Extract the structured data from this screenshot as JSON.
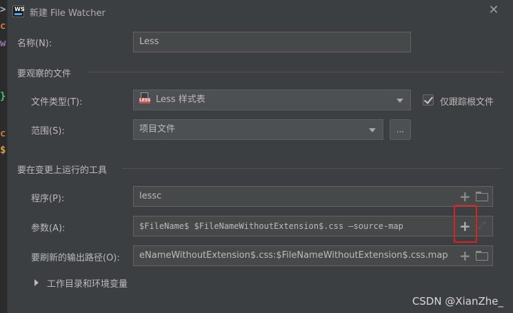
{
  "editor_gutter": {
    "glyphs": [
      {
        "text": ">",
        "color": "#a9b7c6"
      },
      {
        "text": "c",
        "color": "#cc7832"
      },
      {
        "text": "w",
        "color": "#9876aa"
      },
      {
        "text": "}",
        "color": "#3cd070"
      },
      {
        "text": "c",
        "color": "#cc7832"
      },
      {
        "text": "$",
        "color": "#d9a343"
      }
    ]
  },
  "titlebar": {
    "app_icon_text": "WS",
    "title": "新建 File Watcher",
    "close_icon": "close-icon"
  },
  "name_row": {
    "label": "名称(N):",
    "value": "Less"
  },
  "files_section": {
    "title": "要观察的文件",
    "file_type": {
      "label": "文件类型(T):",
      "icon_text": "LESS",
      "selected": "Less 样式表"
    },
    "track_root": {
      "checked": true,
      "label": "仅跟踪根文件"
    },
    "scope": {
      "label": "范围(S):",
      "selected": "项目文件",
      "browse_label": "..."
    }
  },
  "tool_section": {
    "title": "要在变更上运行的工具",
    "program": {
      "label": "程序(P):",
      "value": "lessc"
    },
    "arguments": {
      "label": "参数(A):",
      "value": "$FileName$ $FileNameWithoutExtension$.css —source-map"
    },
    "output_paths": {
      "label": "要刷新的输出路径(O):",
      "value": "eNameWithoutExtension$.css:$FileNameWithoutExtension$.css.map"
    },
    "working_dir_toggle": "工作目录和环境变量"
  },
  "colors": {
    "dialog_bg": "#3c3f41",
    "highlight_border": "#e0201f",
    "less_icon_red": "#c75450"
  },
  "watermark": "CSDN @XianZhe_"
}
